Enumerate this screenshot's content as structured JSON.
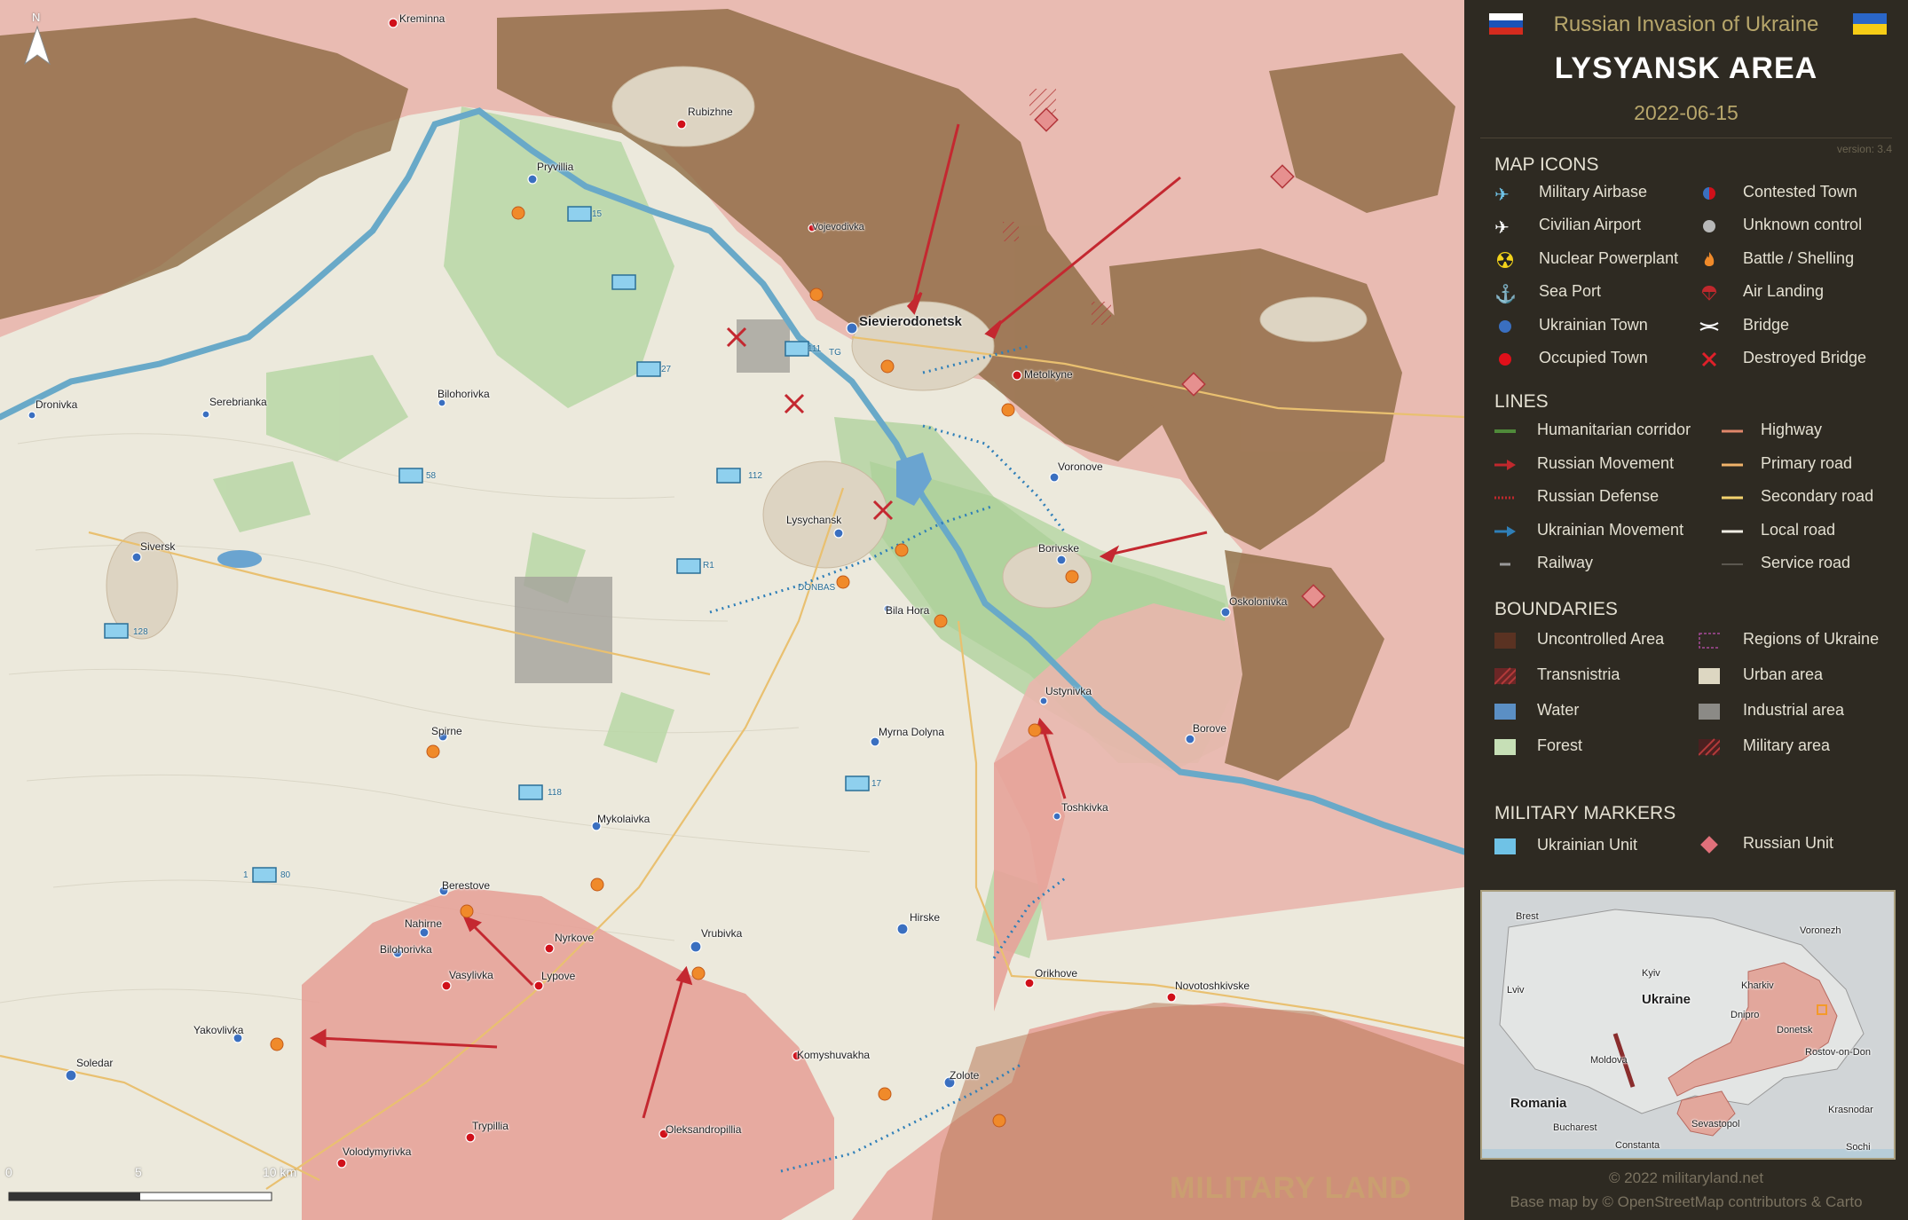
{
  "header": {
    "subtitle": "Russian Invasion of Ukraine",
    "title": "LYSYANSK AREA",
    "date": "2022-06-15",
    "version": "version: 3.4"
  },
  "legend": {
    "map_icons_title": "MAP ICONS",
    "map_icons": [
      {
        "label": "Military Airbase",
        "icon": "airbase-icon"
      },
      {
        "label": "Contested Town",
        "icon": "contested-town-icon"
      },
      {
        "label": "Civilian Airport",
        "icon": "airport-icon"
      },
      {
        "label": "Unknown control",
        "icon": "unknown-control-icon"
      },
      {
        "label": "Nuclear Powerplant",
        "icon": "nuclear-icon"
      },
      {
        "label": "Battle / Shelling",
        "icon": "fire-icon"
      },
      {
        "label": "Sea Port",
        "icon": "anchor-icon"
      },
      {
        "label": "Air Landing",
        "icon": "parachute-icon"
      },
      {
        "label": "Ukrainian Town",
        "icon": "ukrainian-town-icon"
      },
      {
        "label": "Bridge",
        "icon": "bridge-icon"
      },
      {
        "label": "Occupied Town",
        "icon": "occupied-town-icon"
      },
      {
        "label": "Destroyed Bridge",
        "icon": "destroyed-bridge-icon"
      }
    ],
    "lines_title": "LINES",
    "lines": [
      {
        "label": "Humanitarian corridor",
        "color": "#4f8a3a"
      },
      {
        "label": "Highway",
        "color": "#e0876b"
      },
      {
        "label": "Russian Movement",
        "color": "#c0282d"
      },
      {
        "label": "Primary road",
        "color": "#f0b36a"
      },
      {
        "label": "Russian Defense",
        "color": "#c0282d"
      },
      {
        "label": "Secondary road",
        "color": "#f4d36e"
      },
      {
        "label": "Ukrainian Movement",
        "color": "#2f7fb8"
      },
      {
        "label": "Local road",
        "color": "#f0ede4"
      },
      {
        "label": "Railway",
        "color": "#9a9a9a"
      },
      {
        "label": "Service road",
        "color": "#6b6760"
      }
    ],
    "boundaries_title": "BOUNDARIES",
    "boundaries": [
      {
        "label": "Uncontrolled Area",
        "color": "#5a3222"
      },
      {
        "label": "Regions of Ukraine",
        "color": "#a74a9a"
      },
      {
        "label": "Transnistria",
        "color": "#8a2d2d"
      },
      {
        "label": "Urban area",
        "color": "#ddd7c2"
      },
      {
        "label": "Water",
        "color": "#5b8fc4"
      },
      {
        "label": "Industrial area",
        "color": "#8b8a86"
      },
      {
        "label": "Forest",
        "color": "#c6dfb6"
      },
      {
        "label": "Military area",
        "color": "#8a2d2d"
      }
    ],
    "military_title": "MILITARY MARKERS",
    "military": [
      {
        "label": "Ukrainian Unit",
        "color": "#6fc2e6"
      },
      {
        "label": "Russian Unit",
        "color": "#e0707a"
      }
    ]
  },
  "inset": {
    "labels": [
      "Brest",
      "Voronezh",
      "Kyiv",
      "Kharkiv",
      "Lviv",
      "Ukraine",
      "Dnipro",
      "Donetsk",
      "Rostov-on-Don",
      "Moldova",
      "Romania",
      "Krasnodar",
      "Bucharest",
      "Sevastopol",
      "Constanta",
      "Sochi"
    ]
  },
  "map": {
    "north_label": "N",
    "scale_labels": [
      "0",
      "5",
      "10 km"
    ],
    "watermark": "MILITARY LAND",
    "towns": [
      {
        "name": "Kreminna",
        "side": "ru"
      },
      {
        "name": "Rubizhne",
        "side": "ru"
      },
      {
        "name": "Pryvillia",
        "side": "ua"
      },
      {
        "name": "Vojevodivka",
        "side": "ru"
      },
      {
        "name": "Sievierodonetsk",
        "side": "contested"
      },
      {
        "name": "Metolkyne",
        "side": "ru"
      },
      {
        "name": "Dronivka",
        "side": "ua"
      },
      {
        "name": "Serebrianka",
        "side": "ua"
      },
      {
        "name": "Bilohorivka",
        "side": "ua"
      },
      {
        "name": "Voronove",
        "side": "ua"
      },
      {
        "name": "Siversk",
        "side": "ua"
      },
      {
        "name": "Lysychansk",
        "side": "ua"
      },
      {
        "name": "Borivske",
        "side": "ua"
      },
      {
        "name": "Oskolonivka",
        "side": "ua"
      },
      {
        "name": "Bila Hora",
        "side": "ua"
      },
      {
        "name": "Ustynivka",
        "side": "contested"
      },
      {
        "name": "Spirne",
        "side": "ua"
      },
      {
        "name": "Myrna Dolyna",
        "side": "ua"
      },
      {
        "name": "Borove",
        "side": "ua"
      },
      {
        "name": "Mykolaivka",
        "side": "ua"
      },
      {
        "name": "Toshkivka",
        "side": "contested"
      },
      {
        "name": "Berestove",
        "side": "ua"
      },
      {
        "name": "Nahirne",
        "side": "ua"
      },
      {
        "name": "Bilohorivka",
        "side": "ua"
      },
      {
        "name": "Nyrkove",
        "side": "ru"
      },
      {
        "name": "Vrubivka",
        "side": "ua"
      },
      {
        "name": "Hirske",
        "side": "ua"
      },
      {
        "name": "Vasylivka",
        "side": "ru"
      },
      {
        "name": "Lypove",
        "side": "ru"
      },
      {
        "name": "Orikhove",
        "side": "ru"
      },
      {
        "name": "Novotoshkivske",
        "side": "ru"
      },
      {
        "name": "Yakovlivka",
        "side": "ua"
      },
      {
        "name": "Soledar",
        "side": "ua"
      },
      {
        "name": "Komyshuvakha",
        "side": "ru"
      },
      {
        "name": "Zolote",
        "side": "ua"
      },
      {
        "name": "Trypillia",
        "side": "ru"
      },
      {
        "name": "Oleksandropillia",
        "side": "ru"
      },
      {
        "name": "Volodymyrivka",
        "side": "ru"
      }
    ],
    "unit_labels": [
      "15",
      "111",
      "TG",
      "27",
      "58",
      "112",
      "R1",
      "DONBAS",
      "128",
      "118",
      "17",
      "80",
      "1"
    ]
  },
  "footer": {
    "copyright": "© 2022 militaryland.net",
    "credit": "Base map by © OpenStreetMap contributors & Carto"
  }
}
